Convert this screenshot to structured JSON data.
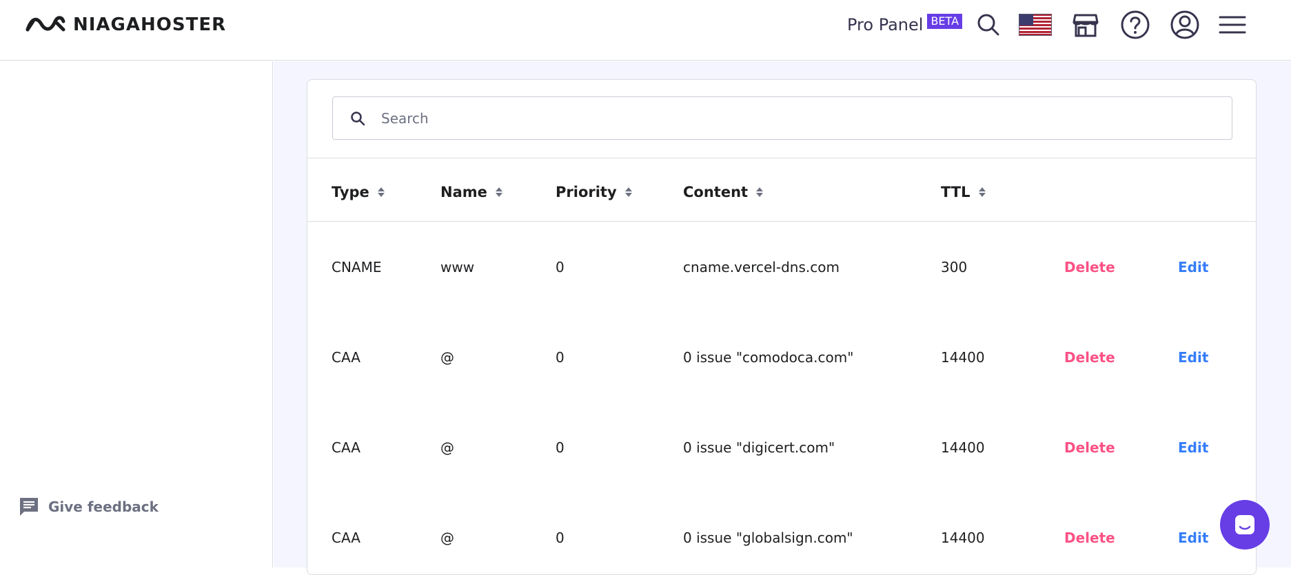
{
  "header": {
    "logo_text": "NIAGAHOSTER",
    "pro_panel_label": "Pro Panel",
    "beta_badge": "BETA",
    "icons": [
      "search-icon",
      "us-flag-icon",
      "store-icon",
      "help-icon",
      "account-icon",
      "menu-icon"
    ]
  },
  "sidebar": {
    "feedback_label": "Give feedback"
  },
  "search": {
    "placeholder": "Search",
    "value": ""
  },
  "table": {
    "columns": [
      "Type",
      "Name",
      "Priority",
      "Content",
      "TTL"
    ],
    "rows": [
      {
        "type": "CNAME",
        "name": "www",
        "priority": "0",
        "content": "cname.vercel-dns.com",
        "ttl": "300",
        "delete": "Delete",
        "edit": "Edit"
      },
      {
        "type": "CAA",
        "name": "@",
        "priority": "0",
        "content": "0 issue \"comodoca.com\"",
        "ttl": "14400",
        "delete": "Delete",
        "edit": "Edit"
      },
      {
        "type": "CAA",
        "name": "@",
        "priority": "0",
        "content": "0 issue \"digicert.com\"",
        "ttl": "14400",
        "delete": "Delete",
        "edit": "Edit"
      },
      {
        "type": "CAA",
        "name": "@",
        "priority": "0",
        "content": "0 issue \"globalsign.com\"",
        "ttl": "14400",
        "delete": "Delete",
        "edit": "Edit"
      }
    ]
  },
  "colors": {
    "brand": "#673de6",
    "delete": "#fc5185",
    "edit": "#357df9",
    "background": "#f4f5ff"
  }
}
